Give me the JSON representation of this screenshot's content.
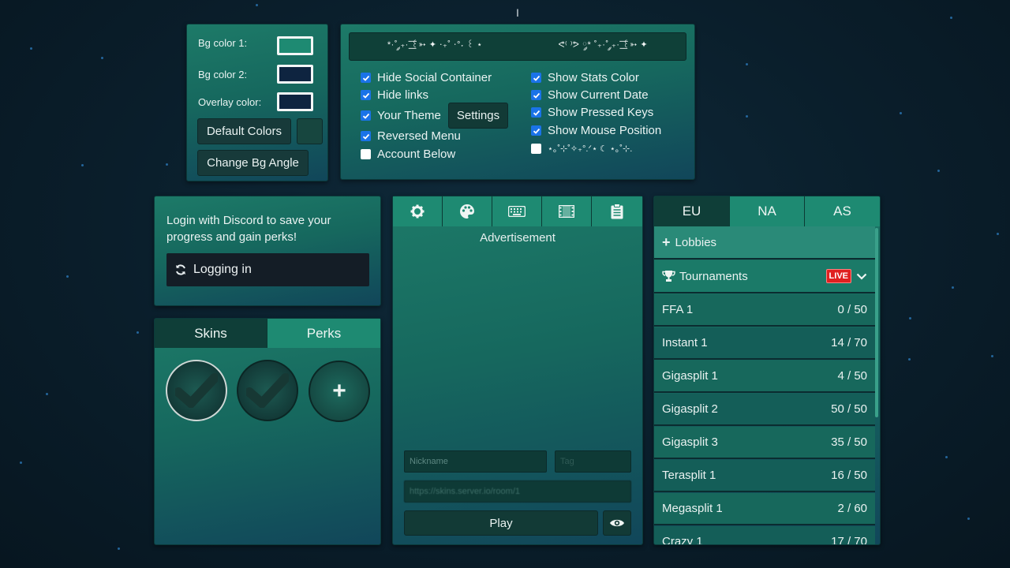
{
  "cursor_text": "I",
  "colors": {
    "bg1": "#1e8a72",
    "bg2": "#0e2440",
    "overlay": "#0e2440",
    "live_badge": "#e02020"
  },
  "color_panel": {
    "bg1_label": "Bg color 1:",
    "bg2_label": "Bg color 2:",
    "overlay_label": "Overlay color:",
    "default_colors_button": "Default Colors",
    "change_angle_button": "Change Bg Angle"
  },
  "settings_panel": {
    "title_left": "*·˚ ༘₊· ͟͟͞͞꒰➳ ✦ ‧₊˚ ⋅°˖ ꒰ ⋆",
    "title_right": "ᕙ⁽ ⁾ᕗ ༘* ˚₊·˚ ༘₊· ͟͟͞͞꒰➳ ✦",
    "checkboxes_left": [
      {
        "label": "Hide Social Container",
        "checked": true
      },
      {
        "label": "Hide links",
        "checked": true
      },
      {
        "label": "Your Theme",
        "checked": true
      },
      {
        "label": "Reversed Menu",
        "checked": true
      },
      {
        "label": "Account Below",
        "checked": false
      }
    ],
    "settings_button": "Settings",
    "checkboxes_right": [
      {
        "label": "Show Stats Color",
        "checked": true
      },
      {
        "label": "Show Current Date",
        "checked": true
      },
      {
        "label": "Show Pressed Keys",
        "checked": true
      },
      {
        "label": "Show Mouse Position",
        "checked": true
      },
      {
        "label": "⋆｡˚⊹˚✧₊°.ᐟ⋆ ☾ ⋆｡˚⊹.",
        "checked": false
      }
    ]
  },
  "login_panel": {
    "message": "Login with Discord to save your progress and gain perks!",
    "button_label": "Logging in"
  },
  "skins_panel": {
    "tabs": [
      "Skins",
      "Perks"
    ],
    "add_symbol": "+"
  },
  "main_panel": {
    "tab_icons": [
      "gear-icon",
      "palette-icon",
      "keyboard-icon",
      "film-icon",
      "clipboard-icon"
    ],
    "advertisement": "Advertisement",
    "nickname_placeholder": "Nickname",
    "tag_placeholder": "Tag",
    "server_placeholder": "https://skins.server.io/room/1",
    "play_button": "Play"
  },
  "servers_panel": {
    "regions": [
      "EU",
      "NA",
      "AS"
    ],
    "lobbies_label": "Lobbies",
    "tournaments_label": "Tournaments",
    "live_label": "LIVE",
    "servers": [
      {
        "name": "FFA 1",
        "players": "0 / 50"
      },
      {
        "name": "Instant 1",
        "players": "14 / 70"
      },
      {
        "name": "Gigasplit 1",
        "players": "4 / 50"
      },
      {
        "name": "Gigasplit 2",
        "players": "50 / 50"
      },
      {
        "name": "Gigasplit 3",
        "players": "35 / 50"
      },
      {
        "name": "Terasplit 1",
        "players": "16 / 50"
      },
      {
        "name": "Megasplit 1",
        "players": "2 / 60"
      },
      {
        "name": "Crazy 1",
        "players": "17 / 70"
      }
    ]
  }
}
